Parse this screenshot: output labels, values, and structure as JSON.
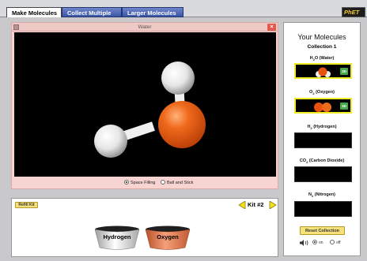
{
  "tabs": [
    {
      "label": "Make Molecules",
      "active": true
    },
    {
      "label": "Collect Multiple",
      "active": false
    },
    {
      "label": "Larger Molecules",
      "active": false
    }
  ],
  "logo": {
    "text": "PhET"
  },
  "viewer": {
    "title": "Water",
    "close_glyph": "×",
    "modes": [
      "Space Filling",
      "Ball and Stick"
    ],
    "selected_mode": "Space Filling"
  },
  "kit": {
    "refill_label": "Refill Kit",
    "label": "Kit #2",
    "buckets": [
      "Hydrogen",
      "Oxygen"
    ]
  },
  "collection": {
    "title": "Your Molecules",
    "subtitle": "Collection 1",
    "molecules": [
      {
        "pre": "H",
        "sub": "2",
        "post": "O (Water)",
        "filled": true,
        "badge": "3D"
      },
      {
        "pre": "O",
        "sub": "2",
        "post": " (Oxygen)",
        "filled": true,
        "badge": "3D"
      },
      {
        "pre": "H",
        "sub": "2",
        "post": " (Hydrogen)",
        "filled": false,
        "badge": ""
      },
      {
        "pre": "CO",
        "sub": "2",
        "post": " (Carbon Dioxide)",
        "filled": false,
        "badge": ""
      },
      {
        "pre": "N",
        "sub": "2",
        "post": " (Nitrogen)",
        "filled": false,
        "badge": ""
      }
    ],
    "reset_label": "Reset Collection",
    "sound_on": "on",
    "sound_off": "off"
  },
  "colors": {
    "oxygen": "#e8520e",
    "hydrogen": "#ffffff",
    "highlight": "#f0ec27",
    "button": "#f7e27a",
    "tab_blue": "#3b56a8"
  },
  "icons": [
    "close-icon",
    "left-arrow-icon",
    "right-arrow-icon",
    "speaker-icon"
  ]
}
